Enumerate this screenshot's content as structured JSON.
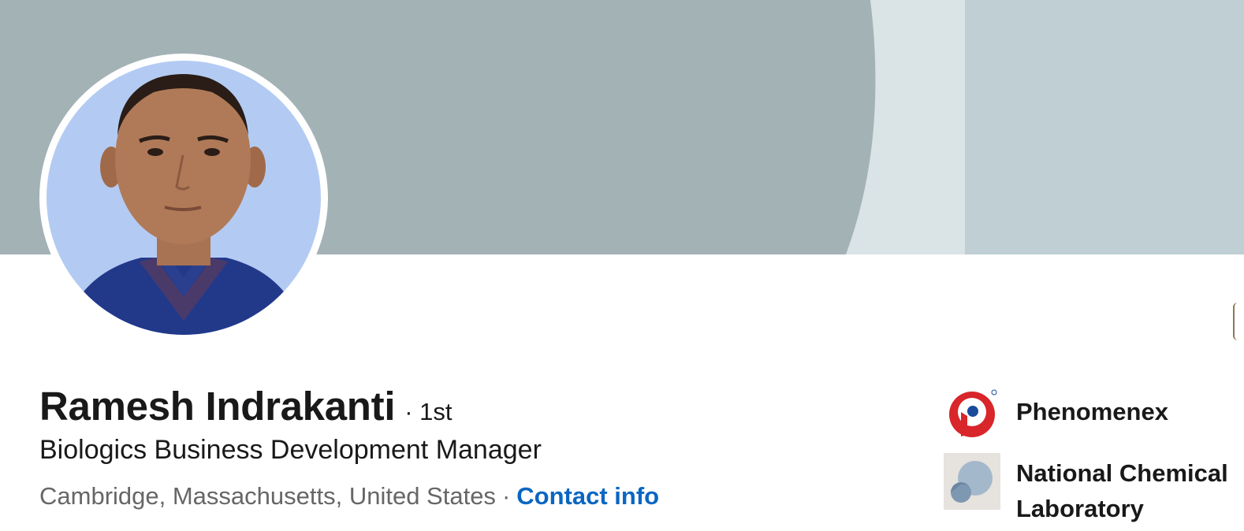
{
  "profile": {
    "name": "Ramesh Indrakanti",
    "degree": "· 1st",
    "headline": "Biologics Business Development Manager",
    "location": "Cambridge, Massachusetts, United States",
    "separator": "·",
    "contact_label": "Contact info"
  },
  "companies": [
    {
      "name": "Phenomenex",
      "icon": "phenomenex-logo"
    },
    {
      "name": "National Chemical Laboratory",
      "icon": "organization-placeholder-logo"
    }
  ],
  "colors": {
    "banner_primary": "#a3b2b5",
    "banner_light": "#dae3e5",
    "banner_right": "#bfcfd3",
    "link": "#0a66c2",
    "text_primary": "#191919",
    "text_secondary": "#666666"
  }
}
